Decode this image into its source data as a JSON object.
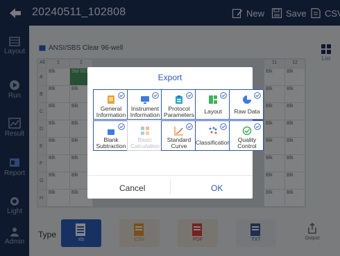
{
  "header": {
    "title": "20240511_102808",
    "new_label": "New",
    "save_label": "Save",
    "csv_label": "CSV"
  },
  "sidebar": {
    "items": [
      {
        "label": "Layout"
      },
      {
        "label": "Run"
      },
      {
        "label": "Result"
      },
      {
        "label": "Report"
      },
      {
        "label": "Light"
      },
      {
        "label": "Admin"
      }
    ]
  },
  "plate": {
    "name": "ANSI/SBS Clear 96-well",
    "columns": [
      "All",
      "1",
      "2",
      "11",
      "12"
    ],
    "rows": [
      "A",
      "B",
      "C",
      "D",
      "E",
      "F",
      "G",
      "H"
    ],
    "cell_text": "Blk",
    "std_text": "Std 001",
    "list_label": "List"
  },
  "bottom": {
    "type_label": "Type",
    "file_types": [
      "xls",
      "CSV",
      "PDF",
      "TXT"
    ],
    "output_label": "Output"
  },
  "dialog": {
    "title": "Export",
    "options": [
      {
        "line1": "General",
        "line2": "Information",
        "enabled": true
      },
      {
        "line1": "Instrument",
        "line2": "Information",
        "enabled": true
      },
      {
        "line1": "Protocol",
        "line2": "Parameters",
        "enabled": true
      },
      {
        "line1": "Layout",
        "line2": "",
        "enabled": true
      },
      {
        "line1": "Raw Data",
        "line2": "",
        "enabled": true
      },
      {
        "line1": "Blank",
        "line2": "Subtraction",
        "enabled": true
      },
      {
        "line1": "Basic",
        "line2": "Calculation",
        "enabled": false
      },
      {
        "line1": "Standard",
        "line2": "Curve",
        "enabled": true
      },
      {
        "line1": "Classification",
        "line2": "",
        "enabled": true
      },
      {
        "line1": "Quality",
        "line2": "Control",
        "enabled": true
      }
    ],
    "cancel_label": "Cancel",
    "ok_label": "OK"
  },
  "colors": {
    "topbar": "#1e3157",
    "accent": "#2c58c4",
    "std_cell": "#4a9a5e",
    "red_cell": "#c0342c"
  }
}
